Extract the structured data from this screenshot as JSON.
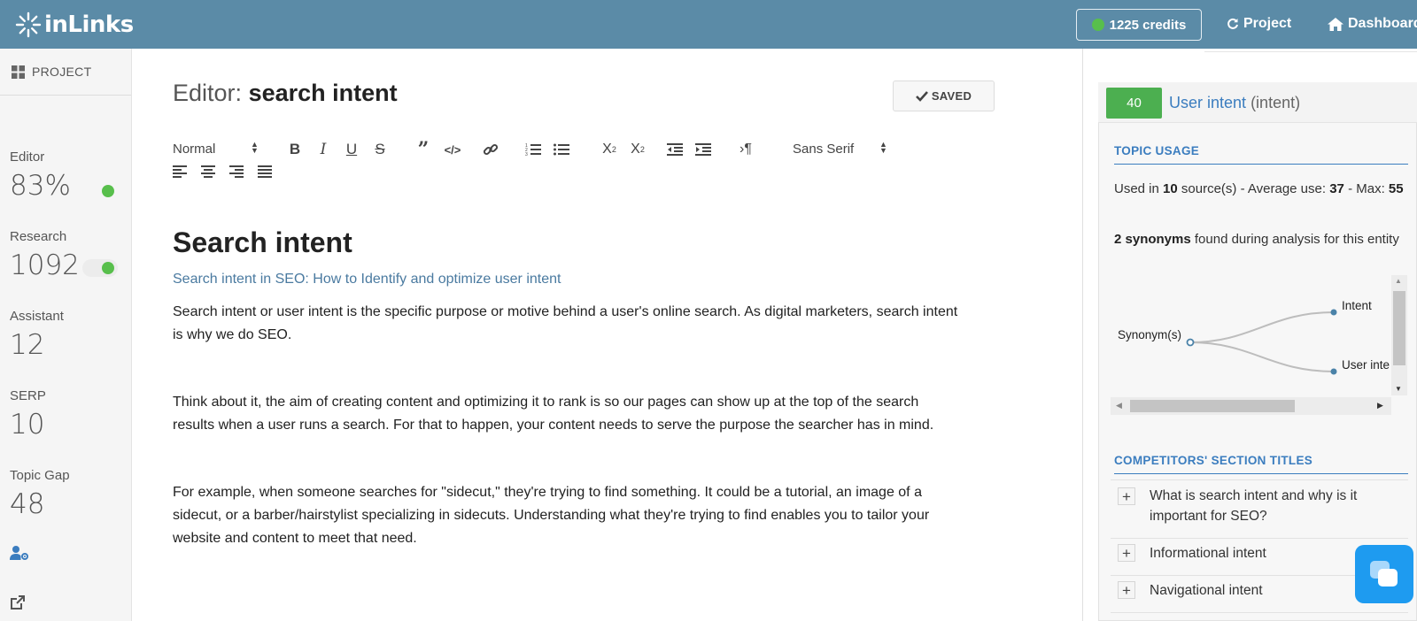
{
  "header": {
    "logo_text": "inLinks",
    "credits_label": "1225 credits",
    "project_link": "Project",
    "dashboard_link": "Dashboard"
  },
  "sidebar": {
    "project_label": "PROJECT",
    "stats": [
      {
        "label": "Editor",
        "value": "83%"
      },
      {
        "label": "Research",
        "value": "1092"
      },
      {
        "label": "Assistant",
        "value": "12"
      },
      {
        "label": "SERP",
        "value": "10"
      },
      {
        "label": "Topic Gap",
        "value": "48"
      }
    ]
  },
  "editor": {
    "title_prefix": "Editor:",
    "title_name": "search intent",
    "saved_label": "SAVED",
    "toolbar": {
      "format_select": "Normal",
      "font_select": "Sans Serif"
    },
    "content": {
      "heading": "Search intent",
      "subheading": "Search intent in SEO: How to Identify and optimize user intent",
      "paragraphs": [
        "Search intent or user intent is the specific purpose or motive behind a user's online search. As digital marketers, search intent is why we do SEO.",
        "Think about it, the aim of creating content and optimizing it to rank is so our pages can show up at the top of the search results when a user runs a search. For that to happen, your content needs to serve the purpose the searcher has in mind.",
        "For example, when someone searches for \"sidecut,\" they're trying to find something. It could be a tutorial, an image of a sidecut, or a barber/hairstylist specializing in sidecuts. Understanding what they're trying to find enables you to tailor your website and content to meet that need."
      ]
    }
  },
  "entity_panel": {
    "score": "40",
    "entity_name": "User intent",
    "entity_type": "(intent)",
    "topic_usage": {
      "heading": "TOPIC USAGE",
      "used_in_prefix": "Used in",
      "sources_count": "10",
      "sources_suffix": "source(s) - Average use:",
      "average_use": "37",
      "max_label": "- Max:",
      "max_use": "55",
      "synonyms_count": "2 synonyms",
      "synonyms_suffix": "found during analysis for this entity"
    },
    "synonym_tree": {
      "root": "Synonym(s)",
      "children": [
        "Intent",
        "User inte"
      ]
    },
    "competitors": {
      "heading": "COMPETITORS' SECTION TITLES",
      "items": [
        "What is search intent and why is it important for SEO?",
        "Informational intent",
        "Navigational intent"
      ]
    }
  },
  "colors": {
    "header_bg": "#5b8ba7",
    "accent_blue": "#3b7dbf",
    "status_green": "#58bf4c",
    "chat_blue": "#1e9bf0"
  }
}
